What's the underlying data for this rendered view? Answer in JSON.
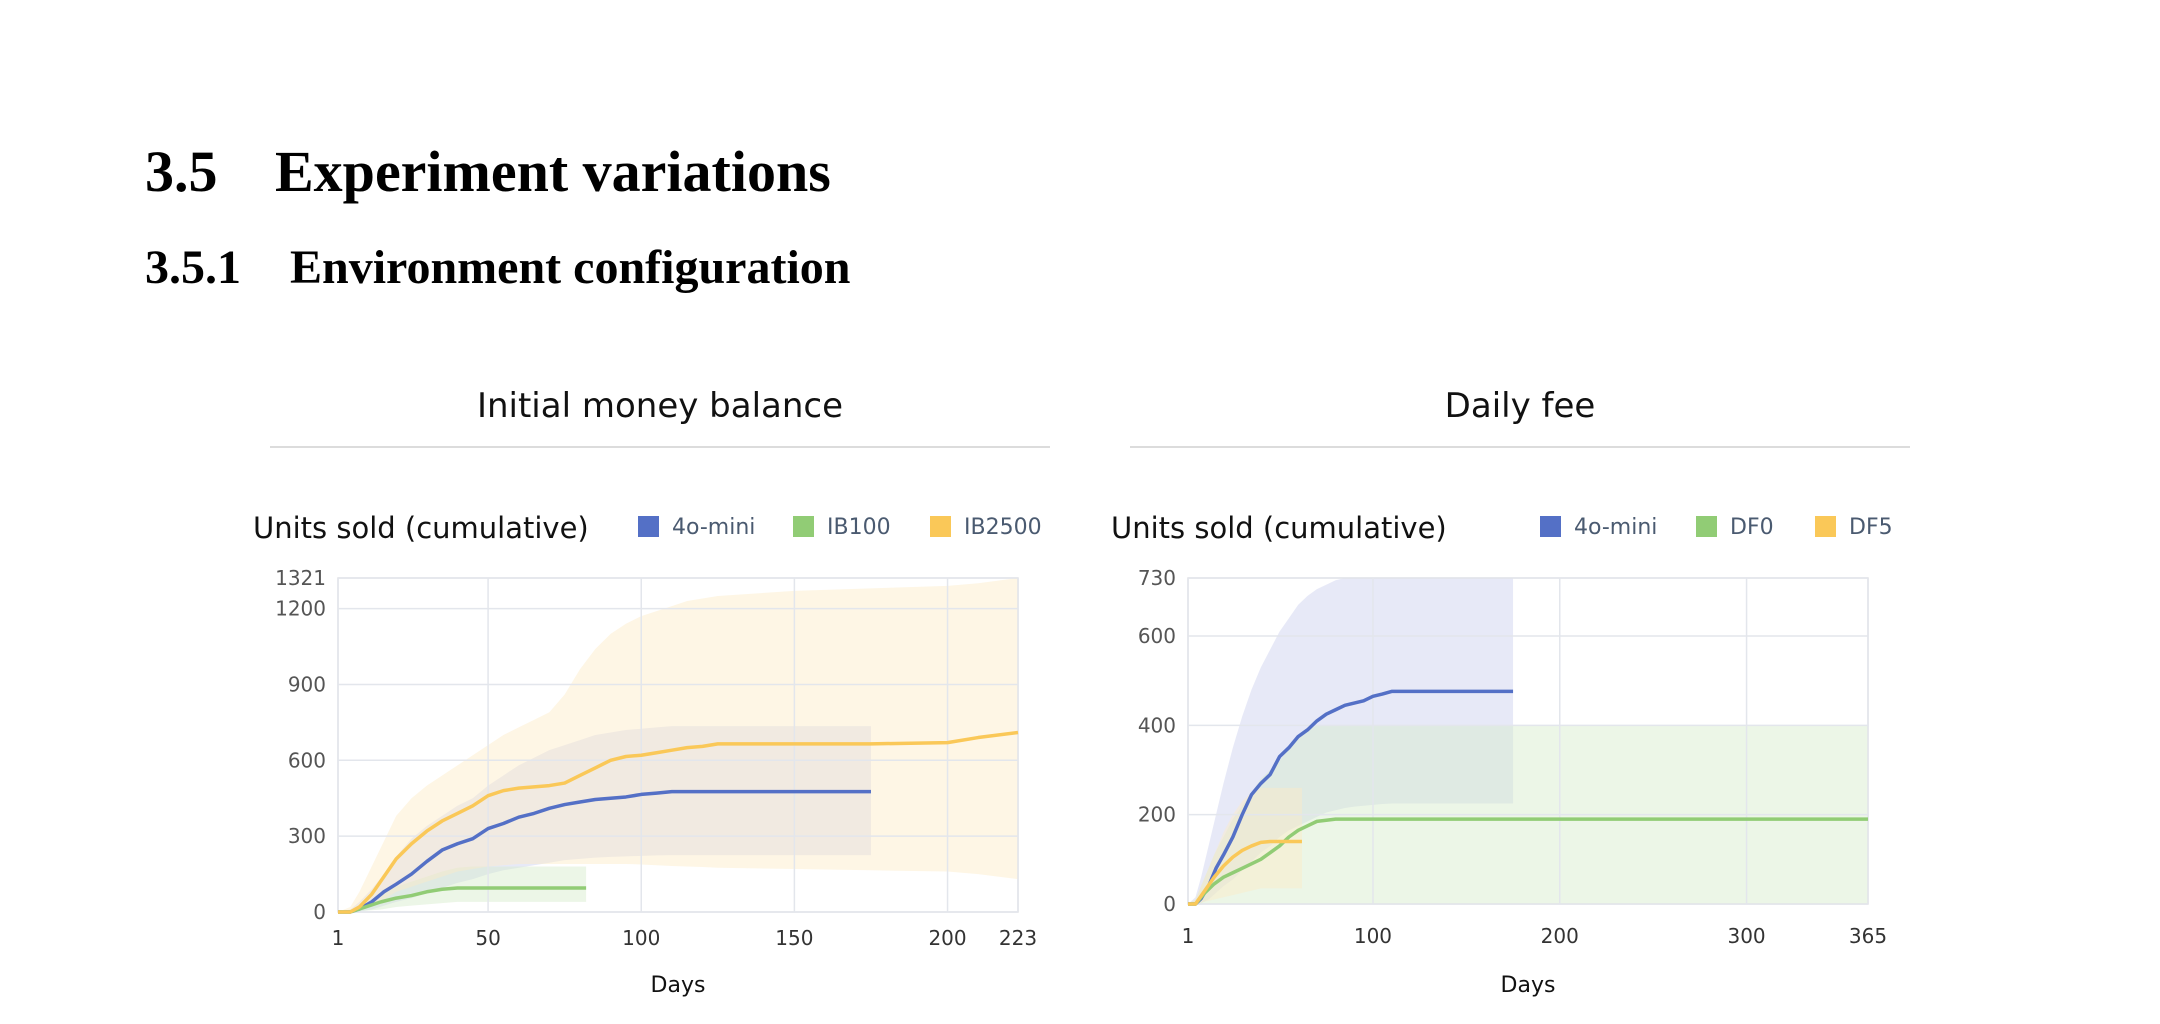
{
  "section": {
    "number": "3.5",
    "title": "Experiment variations"
  },
  "subsection": {
    "number": "3.5.1",
    "title": "Environment configuration"
  },
  "panels": [
    {
      "title": "Initial money balance"
    },
    {
      "title": "Daily fee"
    }
  ],
  "chart_data": [
    {
      "type": "line",
      "title": "Units sold (cumulative)",
      "xlabel": "Days",
      "ylabel": "",
      "xlim": [
        1,
        223
      ],
      "ylim": [
        0,
        1321
      ],
      "x_ticks": [
        1,
        50,
        100,
        150,
        200,
        223
      ],
      "y_ticks": [
        0,
        300,
        600,
        900,
        1200,
        1321
      ],
      "grid": true,
      "legend": "top-right",
      "series": [
        {
          "name": "4o-mini",
          "color": "#5470c6",
          "band_color": "#c9cfee",
          "x": [
            1,
            5,
            8,
            12,
            16,
            20,
            25,
            30,
            35,
            40,
            45,
            50,
            55,
            60,
            65,
            70,
            75,
            80,
            85,
            90,
            95,
            100,
            105,
            110,
            130,
            175
          ],
          "y": [
            0,
            0,
            12,
            40,
            80,
            110,
            150,
            200,
            245,
            270,
            290,
            330,
            350,
            375,
            390,
            410,
            425,
            435,
            445,
            450,
            455,
            465,
            470,
            476,
            476,
            476
          ],
          "band_upper": [
            0,
            10,
            40,
            90,
            150,
            220,
            290,
            340,
            380,
            420,
            450,
            500,
            540,
            580,
            610,
            640,
            660,
            680,
            700,
            710,
            720,
            725,
            730,
            735,
            735,
            735
          ],
          "band_lower": [
            0,
            0,
            2,
            10,
            25,
            40,
            55,
            75,
            95,
            115,
            130,
            150,
            165,
            175,
            185,
            195,
            205,
            210,
            215,
            218,
            220,
            222,
            224,
            225,
            225,
            225
          ]
        },
        {
          "name": "IB100",
          "color": "#91cc75",
          "band_color": "#d5ecc9",
          "x": [
            1,
            5,
            10,
            15,
            20,
            25,
            30,
            35,
            40,
            45,
            50,
            60,
            70,
            82
          ],
          "y": [
            0,
            0,
            20,
            40,
            55,
            65,
            80,
            90,
            95,
            95,
            95,
            95,
            95,
            95
          ],
          "band_upper": [
            0,
            5,
            35,
            70,
            100,
            120,
            140,
            160,
            175,
            180,
            180,
            180,
            180,
            180
          ],
          "band_lower": [
            0,
            0,
            5,
            10,
            20,
            25,
            30,
            35,
            40,
            40,
            40,
            40,
            40,
            40
          ]
        },
        {
          "name": "IB2500",
          "color": "#fac858",
          "band_color": "#fdecc6",
          "x": [
            1,
            5,
            8,
            12,
            16,
            20,
            25,
            30,
            35,
            40,
            45,
            50,
            55,
            60,
            65,
            70,
            75,
            80,
            85,
            90,
            95,
            100,
            105,
            110,
            115,
            120,
            125,
            150,
            175,
            200,
            210,
            223
          ],
          "y": [
            0,
            0,
            20,
            70,
            140,
            210,
            270,
            320,
            360,
            390,
            420,
            460,
            480,
            490,
            495,
            500,
            510,
            540,
            570,
            600,
            615,
            620,
            630,
            640,
            650,
            655,
            665,
            665,
            665,
            670,
            690,
            710
          ],
          "band_upper": [
            0,
            20,
            80,
            180,
            280,
            380,
            450,
            500,
            540,
            580,
            620,
            660,
            700,
            730,
            760,
            790,
            860,
            960,
            1040,
            1100,
            1140,
            1170,
            1190,
            1210,
            1230,
            1240,
            1250,
            1270,
            1280,
            1290,
            1300,
            1321
          ],
          "band_lower": [
            0,
            0,
            5,
            25,
            50,
            80,
            100,
            120,
            140,
            160,
            170,
            180,
            185,
            190,
            190,
            190,
            190,
            190,
            190,
            190,
            190,
            188,
            185,
            182,
            180,
            178,
            175,
            170,
            165,
            160,
            150,
            130
          ]
        }
      ]
    },
    {
      "type": "line",
      "title": "Units sold (cumulative)",
      "xlabel": "Days",
      "ylabel": "",
      "xlim": [
        1,
        365
      ],
      "ylim": [
        0,
        730
      ],
      "x_ticks": [
        1,
        100,
        200,
        300,
        365
      ],
      "y_ticks": [
        0,
        200,
        400,
        600,
        730
      ],
      "grid": true,
      "legend": "top-right",
      "series": [
        {
          "name": "4o-mini",
          "color": "#5470c6",
          "band_color": "#c9cfee",
          "x": [
            1,
            5,
            8,
            12,
            16,
            20,
            25,
            30,
            35,
            40,
            45,
            50,
            55,
            60,
            65,
            70,
            75,
            80,
            85,
            90,
            95,
            100,
            105,
            110,
            130,
            175
          ],
          "y": [
            0,
            0,
            12,
            40,
            80,
            110,
            150,
            200,
            245,
            270,
            290,
            330,
            350,
            375,
            390,
            410,
            425,
            435,
            445,
            450,
            455,
            465,
            470,
            476,
            476,
            476
          ],
          "band_upper": [
            0,
            15,
            60,
            130,
            200,
            270,
            350,
            420,
            480,
            530,
            570,
            610,
            640,
            670,
            690,
            705,
            715,
            725,
            730,
            730,
            730,
            730,
            730,
            730,
            730,
            730
          ],
          "band_lower": [
            0,
            0,
            2,
            10,
            25,
            40,
            55,
            75,
            95,
            115,
            130,
            150,
            165,
            175,
            185,
            195,
            205,
            210,
            215,
            218,
            220,
            222,
            224,
            225,
            225,
            225
          ]
        },
        {
          "name": "DF0",
          "color": "#91cc75",
          "band_color": "#d5ecc9",
          "x": [
            1,
            5,
            10,
            15,
            20,
            25,
            30,
            35,
            40,
            45,
            50,
            55,
            60,
            65,
            70,
            80,
            100,
            200,
            300,
            365
          ],
          "y": [
            0,
            0,
            25,
            45,
            60,
            70,
            80,
            90,
            100,
            115,
            130,
            150,
            165,
            175,
            185,
            190,
            190,
            190,
            190,
            190
          ],
          "band_upper": [
            0,
            10,
            60,
            110,
            150,
            190,
            220,
            250,
            280,
            300,
            320,
            350,
            370,
            390,
            400,
            400,
            400,
            400,
            400,
            400
          ],
          "band_lower": [
            0,
            0,
            0,
            0,
            0,
            0,
            0,
            0,
            0,
            0,
            0,
            0,
            0,
            0,
            0,
            0,
            0,
            0,
            0,
            0
          ],
          "band_upper_lower_bound_note": ""
        },
        {
          "name": "DF5",
          "color": "#fac858",
          "band_color": "#fdecc6",
          "x": [
            1,
            5,
            10,
            15,
            20,
            25,
            30,
            35,
            40,
            45,
            50,
            55,
            62
          ],
          "y": [
            0,
            0,
            30,
            60,
            85,
            105,
            120,
            130,
            138,
            140,
            140,
            140,
            140
          ],
          "band_upper": [
            0,
            10,
            60,
            110,
            160,
            200,
            230,
            250,
            260,
            260,
            260,
            260,
            260
          ],
          "band_lower": [
            0,
            0,
            5,
            10,
            15,
            20,
            25,
            30,
            35,
            35,
            35,
            35,
            35
          ]
        }
      ]
    }
  ]
}
